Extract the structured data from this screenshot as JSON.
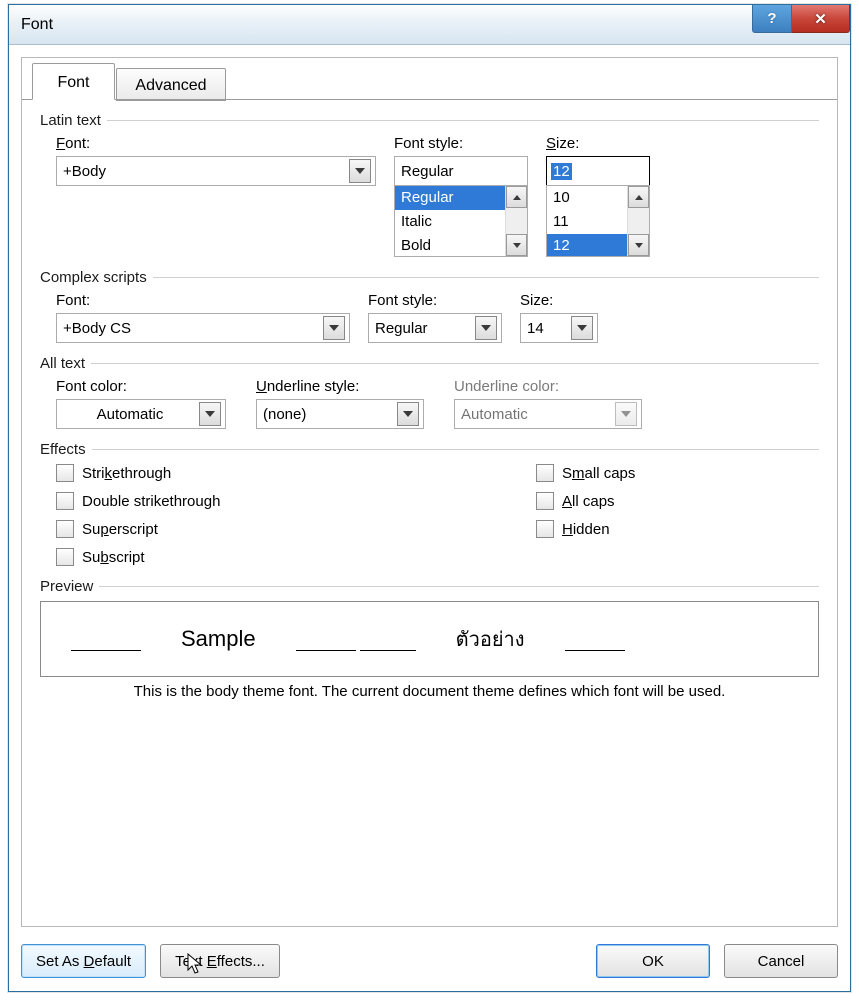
{
  "window": {
    "title": "Font"
  },
  "tabs": {
    "font": "Font",
    "advanced": "Advanced"
  },
  "latin": {
    "heading": "Latin text",
    "font_label_pre": "F",
    "font_label_post": "ont:",
    "font_value": "+Body",
    "style_label": "Font style:",
    "style_value": "Regular",
    "style_items": [
      "Regular",
      "Italic",
      "Bold"
    ],
    "style_selected": "Regular",
    "size_label_pre": "S",
    "size_label_post": "ize:",
    "size_value": "12",
    "size_items": [
      "10",
      "11",
      "12"
    ],
    "size_selected": "12"
  },
  "complex": {
    "heading": "Complex scripts",
    "font_label": "Font:",
    "font_value": "+Body CS",
    "style_label": "Font style:",
    "style_value": "Regular",
    "size_label": "Size:",
    "size_value": "14"
  },
  "alltext": {
    "heading": "All text",
    "color_label": "Font color:",
    "color_value": "Automatic",
    "ul_label_pre": "U",
    "ul_label_post": "nderline style:",
    "ul_value": "(none)",
    "ulc_label": "Underline color:",
    "ulc_value": "Automatic"
  },
  "effects": {
    "heading": "Effects",
    "strike_pre": "Stri",
    "strike_u": "k",
    "strike_post": "ethrough",
    "dstrike": "Double strikethrough",
    "super_pre": "Su",
    "super_u": "p",
    "super_post": "erscript",
    "sub_pre": "Su",
    "sub_u": "b",
    "sub_post": "script",
    "small_pre": "S",
    "small_u": "m",
    "small_post": "all caps",
    "all_pre": "",
    "all_u": "A",
    "all_post": "ll caps",
    "hidden_pre": "",
    "hidden_u": "H",
    "hidden_post": "idden"
  },
  "preview": {
    "heading": "Preview",
    "sample1": "Sample",
    "sample2": "ตัวอย่าง",
    "desc": "This is the body theme font. The current document theme defines which font will be used."
  },
  "buttons": {
    "setdefault_pre": "Set As ",
    "setdefault_u": "D",
    "setdefault_post": "efault",
    "texteffects_pre": "Text ",
    "texteffects_u": "E",
    "texteffects_post": "ffects...",
    "ok": "OK",
    "cancel": "Cancel"
  }
}
